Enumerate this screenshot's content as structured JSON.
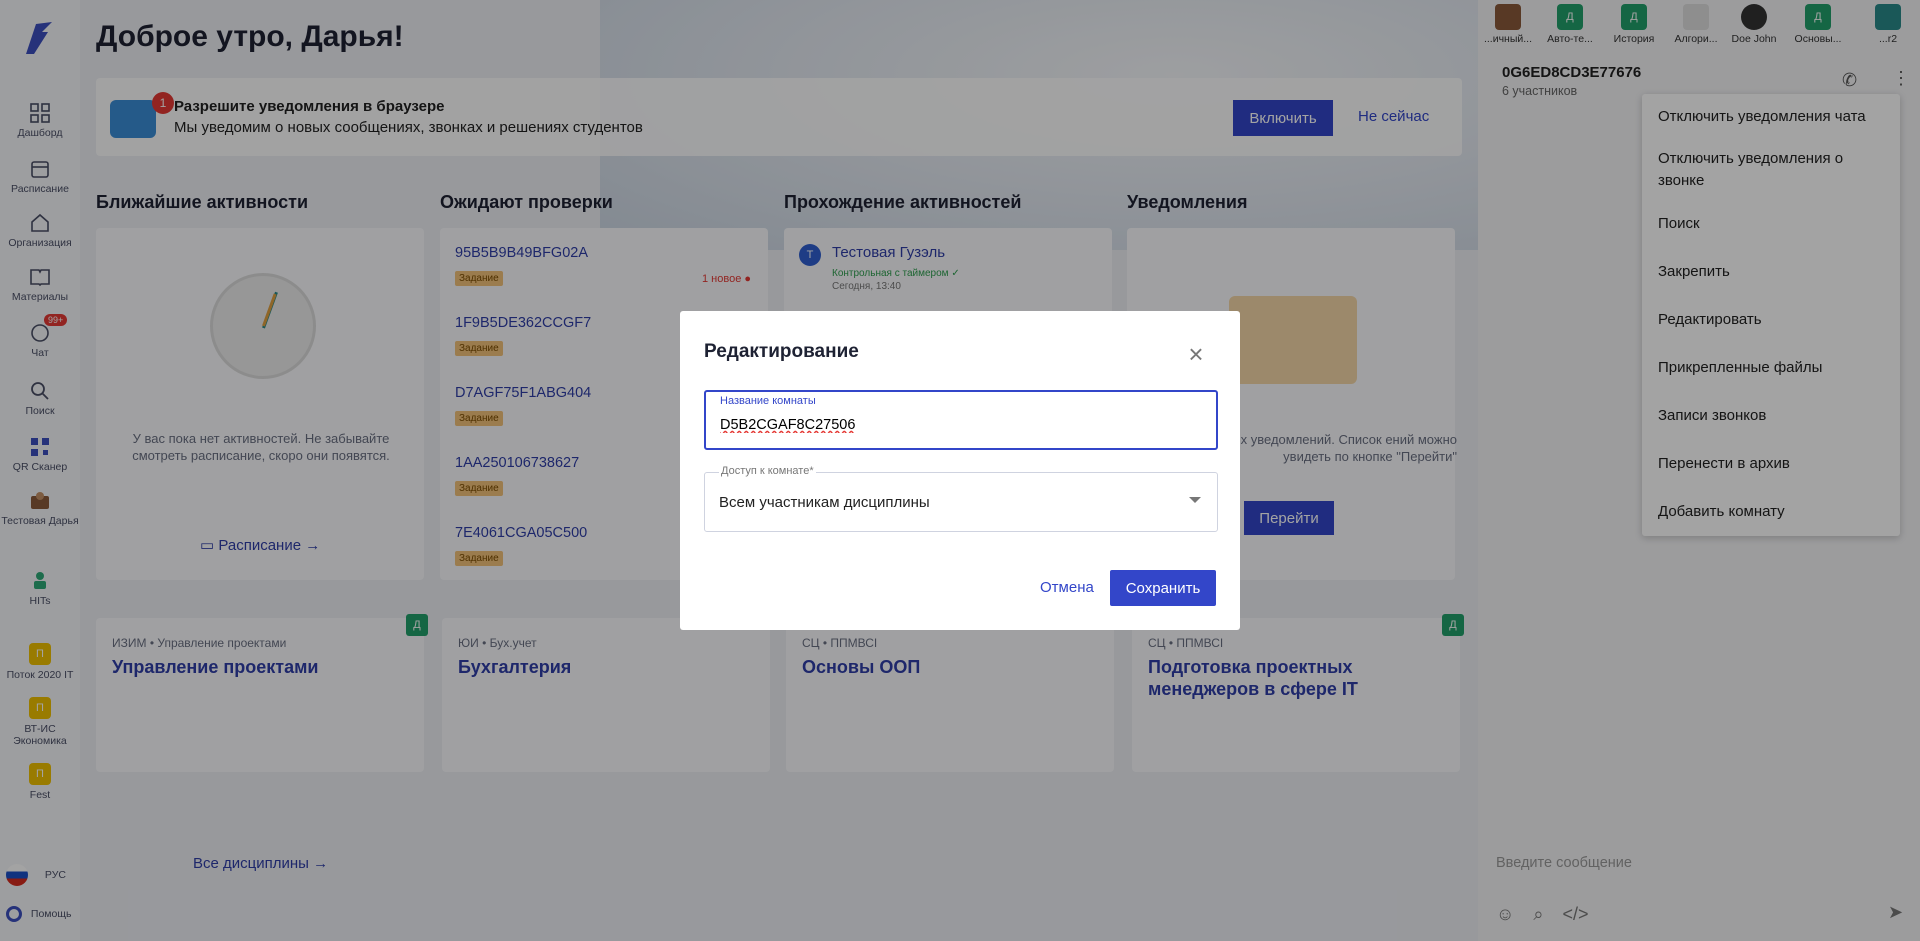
{
  "sidebar": {
    "items": [
      {
        "label": "Дашборд",
        "icon": "dashboard-icon"
      },
      {
        "label": "Расписание",
        "icon": "calendar-icon"
      },
      {
        "label": "Организация",
        "icon": "home-icon"
      },
      {
        "label": "Материалы",
        "icon": "book-icon"
      },
      {
        "label": "Чат",
        "icon": "chat-icon",
        "badge": "99+"
      },
      {
        "label": "Поиск",
        "icon": "search-icon"
      },
      {
        "label": "QR Сканер",
        "icon": "qr-icon"
      },
      {
        "label": "Тестовая Дарья",
        "icon": "avatar-icon"
      },
      {
        "label": "HITs",
        "icon": "hits-icon"
      }
    ],
    "disciplines": [
      {
        "letter": "П",
        "label": "Поток 2020 IT"
      },
      {
        "letter": "П",
        "label": "ВТ-ИС Экономика"
      },
      {
        "letter": "П",
        "label": "Fest"
      }
    ],
    "lang": "РУС",
    "help": "Помощь"
  },
  "main": {
    "greeting": "Доброе утро, Дарья!",
    "notify": {
      "badge": "1",
      "title": "Разрешите уведомления в браузере",
      "text": "Мы уведомим о новых сообщениях, звонках и решениях студентов",
      "enable": "Включить",
      "later": "Не сейчас"
    },
    "columns": {
      "upcoming": "Ближайшие активности",
      "review": "Ожидают проверки",
      "passing": "Прохождение активностей",
      "notifications": "Уведомления"
    },
    "upcoming": {
      "empty": "У вас пока нет активностей. Не забывайте смотреть расписание, скоро они появятся.",
      "link": "Расписание"
    },
    "review": [
      {
        "name": "95B5B9B49BFG02A",
        "tag": "Задание",
        "new": "1 новое ●"
      },
      {
        "name": "1F9B5DE362CCGF7",
        "tag": "Задание"
      },
      {
        "name": "D7AGF75F1ABG404",
        "tag": "Задание"
      },
      {
        "name": "1AA250106738627",
        "tag": "Задание"
      },
      {
        "name": "7E4061CGA05C500",
        "tag": "Задание"
      }
    ],
    "passing": {
      "avatar": "Т",
      "name": "Тестовая Гузэль",
      "sub": "Контрольная с таймером ✓",
      "time": "Сегодня, 13:40"
    },
    "notifications": {
      "text": "олученных уведомлений. Список ений можно увидеть по кнопке \"Перейти\"",
      "button": "Перейти"
    },
    "disciplines": [
      {
        "crumb": "ИЗИМ • Управление проектами",
        "name": "Управление проектами",
        "badge": "Д"
      },
      {
        "crumb": "ЮИ • Бух.учет",
        "name": "Бухгалтерия",
        "badge": ""
      },
      {
        "crumb": "СЦ • ППМВСI",
        "name": "Основы ООП",
        "badge": ""
      },
      {
        "crumb": "СЦ • ППМВСI",
        "name": "Подготовка проектных менеджеров в сфере IT",
        "badge": "Д"
      }
    ],
    "all_disc": "Все дисциплины →"
  },
  "chat": {
    "tabs": [
      {
        "label": "...ичный...",
        "letter": ""
      },
      {
        "label": "Авто-те...",
        "letter": "Д"
      },
      {
        "label": "История",
        "letter": "Д"
      },
      {
        "label": "Алгори...",
        "letter": ""
      },
      {
        "label": "Doe John",
        "letter": ""
      },
      {
        "label": "Основы...",
        "letter": "Д"
      },
      {
        "label": "...r2",
        "letter": ""
      }
    ],
    "room_title": "0G6ED8CD3E77676",
    "room_sub": "6 участников",
    "menu": [
      "Отключить уведомления чата",
      "Отключить уведомления о звонке",
      "Поиск",
      "Закрепить",
      "Редактировать",
      "Прикрепленные файлы",
      "Записи звонков",
      "Перенести в архив",
      "Добавить комнату"
    ],
    "input_placeholder": "Введите сообщение"
  },
  "modal": {
    "title": "Редактирование",
    "room_name_label": "Название комнаты",
    "room_name_value": "D5B2CGAF8C27506",
    "access_label": "Доступ к комнате*",
    "access_value": "Всем участникам дисциплины",
    "cancel": "Отмена",
    "save": "Сохранить"
  },
  "colors": {
    "accent": "#3346c9",
    "badge": "#e53935",
    "discipline_badge": "#22a06b",
    "discipline_square": "#f0c000"
  }
}
